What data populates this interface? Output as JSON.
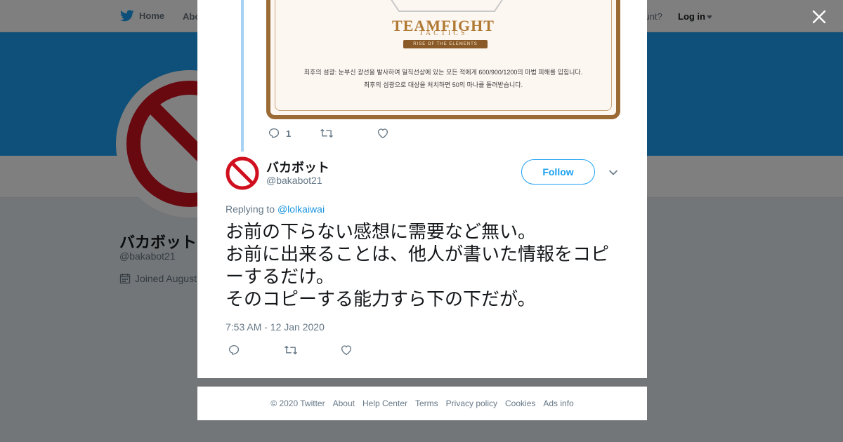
{
  "nav": {
    "home_label": "Home",
    "about_label": "Abo",
    "have_account_label": "account?",
    "login_label": "Log in"
  },
  "profile": {
    "name": "バカボット",
    "handle": "@bakabot21",
    "joined": "Joined August"
  },
  "card_image": {
    "game_title": "TEAMFIGHT",
    "game_subtitle": "TACTICS",
    "ribbon": "RISE OF THE ELEMENTS",
    "ability_line1": "최후의 섬광: 눈부신 광선을 발사하여 일직선상에 있는 모든 적에게 600/900/1200의 마법 피해를 입힙니다.",
    "ability_line2": "최후의 섬광으로 대상을 처치하면 50의 마나를 돌려받습니다."
  },
  "parent_actions": {
    "reply_count": "1"
  },
  "tweet": {
    "author_name": "バカボット",
    "author_handle": "@bakabot21",
    "follow_label": "Follow",
    "replying_prefix": "Replying to",
    "replying_to": "@lolkaiwai",
    "text": "お前の下らない感想に需要など無い。\nお前に出来ることは、他人が書いた情報をコピーするだけ。\nそのコピーする能力すら下の下だが。",
    "timestamp": "7:53 AM - 12 Jan 2020"
  },
  "footer": {
    "copyright": "© 2020 Twitter",
    "links": [
      "About",
      "Help Center",
      "Terms",
      "Privacy policy",
      "Cookies",
      "Ads info"
    ]
  },
  "colors": {
    "brand": "#1da1f2",
    "link": "#1b95e0",
    "muted": "#657786",
    "thread_line": "#a6d2f3",
    "prohibited_red": "#d0101e"
  },
  "icons": [
    "twitter-bird-icon",
    "calendar-icon",
    "close-icon",
    "reply-icon",
    "retweet-icon",
    "like-icon",
    "chevron-down-icon",
    "prohibited-icon"
  ]
}
